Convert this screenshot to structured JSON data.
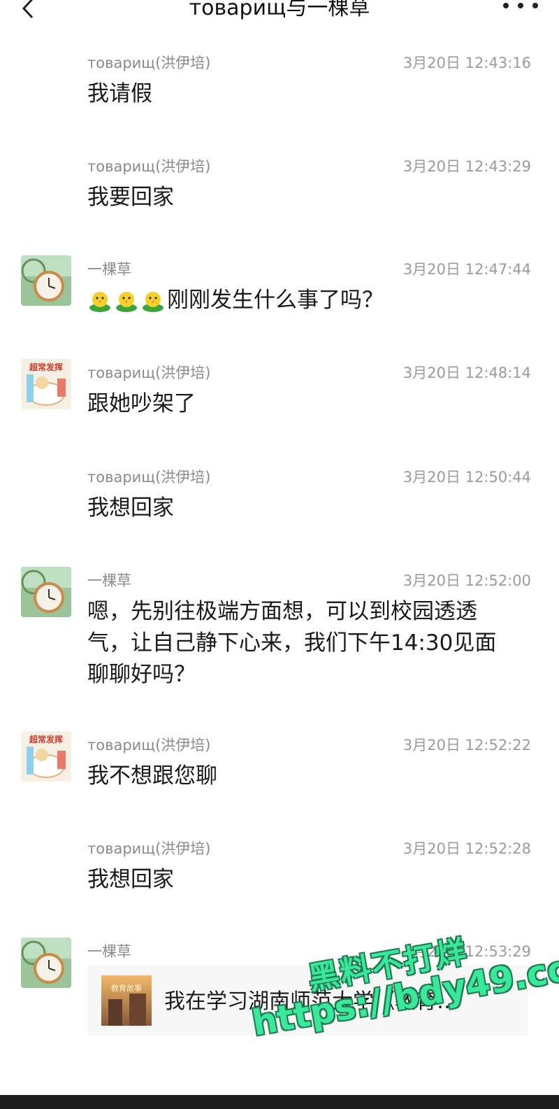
{
  "header": {
    "title": "товарищ与一棵草"
  },
  "messages": [
    {
      "sender": "товарищ(洪伊培)",
      "time": "3月20日 12:43:16",
      "text": "我请假",
      "avatar": "none"
    },
    {
      "sender": "товарищ(洪伊培)",
      "time": "3月20日 12:43:29",
      "text": "我要回家",
      "avatar": "none"
    },
    {
      "sender": "一棵草",
      "time": "3月20日 12:47:44",
      "text": "刚刚发生什么事了吗？",
      "emoji_count": 3,
      "emoji_name": "chick-emoji",
      "avatar": "pocket-watch"
    },
    {
      "sender": "товарищ(洪伊培)",
      "time": "3月20日 12:48:14",
      "text": "跟她吵架了",
      "avatar": "cartoon-sticker"
    },
    {
      "sender": "товарищ(洪伊培)",
      "time": "3月20日 12:50:44",
      "text": "我想回家",
      "avatar": "none"
    },
    {
      "sender": "一棵草",
      "time": "3月20日 12:52:00",
      "text_lines": [
        "嗯，先别往极端方面想，可以到校园透透",
        "气，让自己静下心来，我们下午14:30见面",
        "聊聊好吗？"
      ],
      "avatar": "pocket-watch"
    },
    {
      "sender": "товарищ(洪伊培)",
      "time": "3月20日 12:52:22",
      "text": "我不想跟您聊",
      "avatar": "cartoon-sticker"
    },
    {
      "sender": "товарищ(洪伊培)",
      "time": "3月20日 12:52:28",
      "text": "我想回家",
      "avatar": "none"
    },
    {
      "sender": "一棵草",
      "time": "3月20日 12:53:29",
      "avatar": "pocket-watch"
    }
  ],
  "share_card": {
    "title": "我在学习湖南师范大学《教育…",
    "thumb_text": "教育故事"
  },
  "avatar_sticker_text": "超常发挥",
  "watermark": {
    "line1": "黑料不打烊",
    "line2": "https://bdy49.co"
  },
  "colors": {
    "watermark_fill": "#39e89a",
    "watermark_outline": "#1f7a4f",
    "meta_gray": "#8a8a8a"
  }
}
